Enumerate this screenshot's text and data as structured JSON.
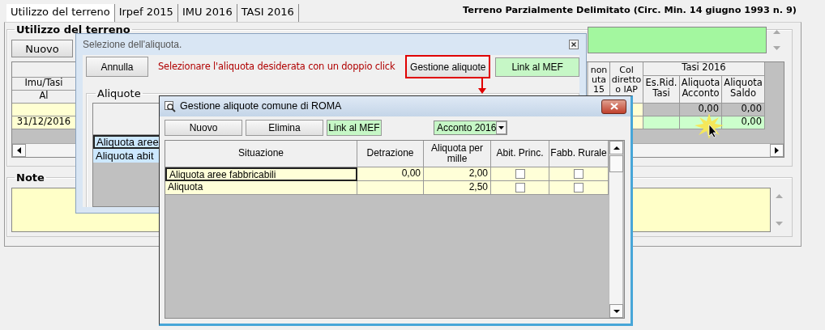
{
  "tabs": [
    {
      "label": "Utilizzo del terreno",
      "selected": true
    },
    {
      "label": "Irpef 2015",
      "selected": false
    },
    {
      "label": "IMU 2016",
      "selected": false
    },
    {
      "label": "TASI 2016",
      "selected": false
    }
  ],
  "form_title": "Terreno Parzialmente Delimitato (Circ. Min. 14 giugno 1993 n. 9)",
  "usage_group": {
    "title": "Utilizzo del terreno",
    "new_button": "Nuovo",
    "grid": {
      "left_headers": [
        "Imu/Tasi",
        "Al"
      ],
      "right_columns": [
        "non uta 15",
        "Col diretto o IAP"
      ],
      "group_header": "Tasi 2016",
      "group_columns": [
        "Es.Rid. Tasi",
        "Aliquota Acconto",
        "Aliquota Saldo"
      ],
      "rows": [
        {
          "editable": false,
          "acconto": "0,00",
          "saldo": "0,00"
        },
        {
          "editable": true,
          "al": "31/12/2016",
          "saldo": "0,00"
        }
      ]
    }
  },
  "note_group": {
    "title": "Note"
  },
  "select_dialog": {
    "title": "Selezione dell'aliquota.",
    "cancel_button": "Annulla",
    "instruction": "Selezionare l'aliquota desiderata con un doppio click",
    "manage_button": {
      "label": "Gestione aliquote",
      "highlighted": true
    },
    "mef_button": "Link al MEF",
    "group_title": "Aliquote",
    "items": [
      {
        "label": "Aliquota aree",
        "selected": true,
        "focused": true
      },
      {
        "label": "Aliquota abit",
        "selected": true,
        "focused": false
      }
    ]
  },
  "manage_dialog": {
    "title": "Gestione aliquote comune di ROMA",
    "buttons": [
      {
        "label": "Nuovo",
        "kind": "plain"
      },
      {
        "label": "Elimina",
        "kind": "plain"
      },
      {
        "label": "Link al MEF",
        "kind": "green"
      }
    ],
    "period_select": "Acconto 2016",
    "columns": [
      "Situazione",
      "Detrazione",
      "Aliquota per mille",
      "Abit. Princ.",
      "Fabb. Rurale"
    ],
    "rows": [
      {
        "situazione": "Aliquota aree fabbricabili",
        "detrazione": "0,00",
        "aliquota": "2,00",
        "abit_princ": false,
        "fabb_rurale": false,
        "focused": true
      },
      {
        "situazione": "Aliquota",
        "aliquota": "2,50",
        "abit_princ": false,
        "fabb_rurale": false,
        "focused": false
      }
    ]
  }
}
